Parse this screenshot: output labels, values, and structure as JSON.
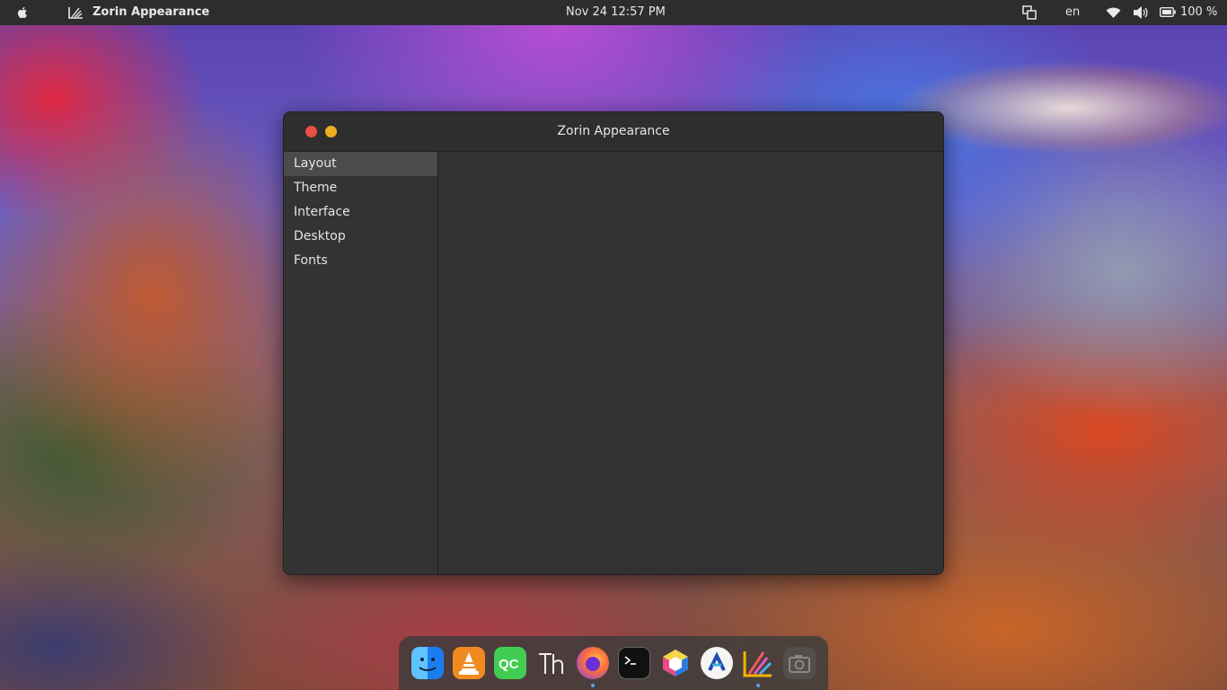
{
  "topbar": {
    "app_name": "Zorin Appearance",
    "clock": "Nov 24  12:57 PM",
    "language": "en",
    "battery_percent": "100 %"
  },
  "window": {
    "title": "Zorin Appearance",
    "sidebar": {
      "items": [
        {
          "label": "Layout",
          "active": true
        },
        {
          "label": "Theme"
        },
        {
          "label": "Interface"
        },
        {
          "label": "Desktop"
        },
        {
          "label": "Fonts"
        }
      ]
    }
  },
  "dock": {
    "apps": [
      {
        "name": "finder-icon",
        "color": "#2a8cf0",
        "running": false
      },
      {
        "name": "vlc-icon",
        "color": "#f08a20",
        "running": false
      },
      {
        "name": "qt-creator-icon",
        "color": "#41cd52",
        "running": false
      },
      {
        "name": "font-viewer-icon",
        "color": "#3a3a3a",
        "running": false
      },
      {
        "name": "firefox-icon",
        "color": "#7b3ff2",
        "running": true
      },
      {
        "name": "terminal-icon",
        "color": "#111111",
        "running": false
      },
      {
        "name": "virtualbox-icon",
        "color": "#2dc6a8",
        "running": false
      },
      {
        "name": "web-browser-icon",
        "color": "#f5f5f5",
        "running": false
      },
      {
        "name": "zorin-appearance-icon",
        "color": "#e85a9a",
        "running": true
      },
      {
        "name": "screenshot-icon",
        "color": "#555555",
        "running": false
      }
    ]
  },
  "colors": {
    "topbar_bg": "#2d2d2d",
    "window_bg": "#323232",
    "close_button": "#ea5046",
    "minimize_button": "#efae23",
    "active_item_bg": "#4b4b4b"
  }
}
